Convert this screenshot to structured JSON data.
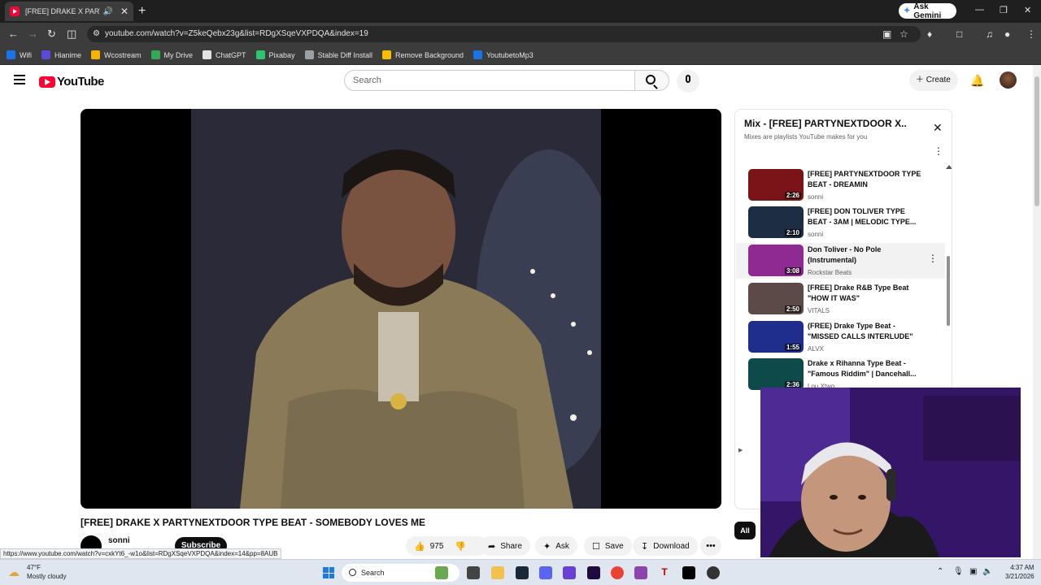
{
  "browser": {
    "tab_title": "[FREE] DRAKE X PARTYNEXTDOOR TYPE BEAT - SOMEBODY LOVES ME",
    "new_tab": "+",
    "ask_gemini": "Ask Gemini",
    "url": "youtube.com/watch?v=Z5keQebx23g&list=RDgXSqeVXPDQA&index=19",
    "bookmarks": [
      {
        "label": "Wifi",
        "color": "#1a73e8"
      },
      {
        "label": "Hianime",
        "color": "#5b4bdb"
      },
      {
        "label": "Wcostream",
        "color": "#f4b400"
      },
      {
        "label": "My Drive",
        "color": "#34a853"
      },
      {
        "label": "ChatGPT",
        "color": "#e3e3e3"
      },
      {
        "label": "Pixabay",
        "color": "#2ec66d"
      },
      {
        "label": "Stable Diff Install",
        "color": "#9aa0a6"
      },
      {
        "label": "Remove Background",
        "color": "#fbbc04"
      },
      {
        "label": "YoutubetoMp3",
        "color": "#1a73e8"
      }
    ]
  },
  "youtube": {
    "logo_text": "YouTube",
    "search_placeholder": "Search",
    "create_label": "Create"
  },
  "video": {
    "title": "[FREE] DRAKE X PARTYNEXTDOOR TYPE BEAT - SOMEBODY LOVES ME",
    "channel": "sonni",
    "subscribe": "Subscribe",
    "likes": "975",
    "share": "Share",
    "ask": "Ask",
    "save": "Save",
    "download": "Download",
    "more": "•••"
  },
  "status_url": "https://www.youtube.com/watch?v=cxkYt6_-w1o&list=RDgXSqeVXPDQA&index=14&pp=8AUB",
  "playlist": {
    "title": "Mix - [FREE] PARTYNEXTDOOR X...",
    "subtitle": "Mixes are playlists YouTube makes for you",
    "items": [
      {
        "title": "[FREE] PARTYNEXTDOOR TYPE BEAT - DREAMIN",
        "channel": "sonni",
        "duration": "2:26",
        "thumb": "#7a1418"
      },
      {
        "title": "[FREE] DON TOLIVER TYPE BEAT - 3AM | MELODIC TYPE...",
        "channel": "sonni",
        "duration": "2:10",
        "thumb": "#1d2e44"
      },
      {
        "title": "Don Toliver - No Pole (Instrumental)",
        "channel": "Rockstar Beats",
        "duration": "3:08",
        "thumb": "#8e2a92"
      },
      {
        "title": "[FREE] Drake R&B Type Beat \"HOW IT WAS\"",
        "channel": "VITALS",
        "duration": "2:50",
        "thumb": "#5c4a48"
      },
      {
        "title": "(FREE) Drake Type Beat - \"MISSED CALLS INTERLUDE\"",
        "channel": "ALVX",
        "duration": "1:55",
        "thumb": "#1f2d8c"
      },
      {
        "title": "Drake x Rihanna Type Beat - \"Famous Riddim\" | Dancehall...",
        "channel": "Lou Xtwo",
        "duration": "2:36",
        "thumb": "#0f4a4a"
      }
    ]
  },
  "chips": {
    "all": "All"
  },
  "taskbar": {
    "temp": "47°F",
    "weather": "Mostly cloudy",
    "search": "Search",
    "time": "4:37 AM",
    "date": "3/21/2026"
  }
}
